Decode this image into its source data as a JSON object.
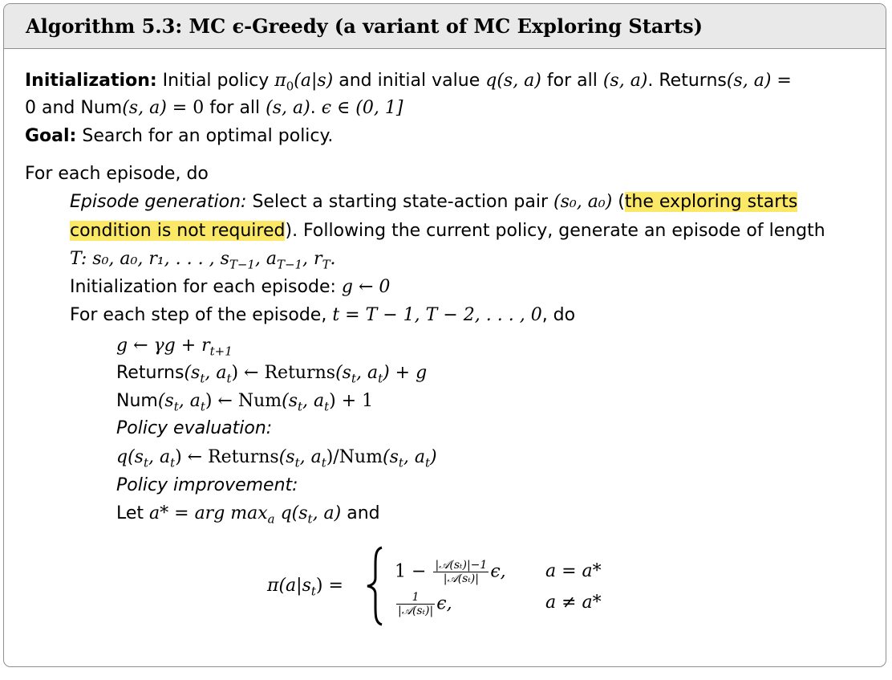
{
  "algorithm": {
    "title": "Algorithm 5.3: MC ϵ-Greedy (a variant of MC Exploring Starts)"
  },
  "init": {
    "label": "Initialization:",
    "text1a": "Initial policy ",
    "pi0": "π",
    "pi0_sub": "0",
    "text1b": "(a|s)",
    "text1c": " and initial value ",
    "q_sa": "q(s, a)",
    "text1d": " for all ",
    "sa1": "(s, a)",
    "text1e": ". Returns",
    "sa2": "(s, a)",
    "eq": " =",
    "text2a": "0 and Num",
    "sa3": "(s, a)",
    "text2b": " = 0",
    "text2c": " for all ",
    "sa4": "(s, a)",
    "text2d": ". ",
    "eps_range": "ϵ ∈ (0, 1]"
  },
  "goal": {
    "label": "Goal:",
    "text": " Search for an optimal policy."
  },
  "loop": {
    "for_each_episode": "For each episode, do",
    "episode_generation_label": "Episode generation:",
    "episode_generation_text1": " Select a starting state-action pair ",
    "s0a0": "(s₀, a₀)",
    "paren_open": " (",
    "highlight1": "the exploring starts",
    "highlight2": "condition is not required",
    "after_highlight": "). Following the current policy, generate an episode of length",
    "T_line": "T:  s₀, a₀, r₁, . . . , s",
    "T_line_sub1": "T−1",
    "T_line_mid": ", a",
    "T_line_sub2": "T−1",
    "T_line_mid2": ", r",
    "T_line_sub3": "T",
    "T_line_end": ".",
    "init_each_episode": "Initialization for each episode:  ",
    "g_init": "g ← 0",
    "for_each_step": "For each step of the episode, ",
    "t_seq": "t = T − 1, T − 2, . . . , 0",
    "do": ", do"
  },
  "inner": {
    "g_update": "g ← γg + r",
    "g_update_sub": "t+1",
    "returns_line_a": "Returns",
    "returns_line_b": "(s",
    "returns_line_c": ", a",
    "returns_line_d": ") ← Returns",
    "returns_line_e": "(s",
    "returns_line_f": ", a",
    "returns_line_g": ") + g",
    "num_line_a": "Num",
    "num_line_b": "(s",
    "num_line_c": ", a",
    "num_line_d": ") ← Num",
    "num_line_e": "(s",
    "num_line_f": ", a",
    "num_line_g": ") + 1",
    "policy_eval_label": "Policy evaluation:",
    "q_line_a": "q(s",
    "q_line_b": ", a",
    "q_line_c": ") ← Returns",
    "q_line_d": "(s",
    "q_line_e": ", a",
    "q_line_f": ")/Num",
    "q_line_g": "(s",
    "q_line_h": ", a",
    "q_line_i": ")",
    "policy_impr_label": "Policy improvement:",
    "let_a": "Let ",
    "a_star": "a* = arg max",
    "a_star_sub": "a",
    "a_star_rest": " q(s",
    "a_star_rest2": ", a)",
    "and": " and"
  },
  "formula": {
    "lhs": "π(a|s",
    "lhs_sub": "t",
    "lhs_end": ") =",
    "case1_prefix": "1 −",
    "case1_num": "|𝒜(sₜ)|−1",
    "case1_den": "|𝒜(sₜ)|",
    "case1_eps": "ϵ,",
    "case1_cond": "a = a*",
    "case2_num": "1",
    "case2_den": "|𝒜(sₜ)|",
    "case2_eps": "ϵ,",
    "case2_cond": "a ≠ a*"
  },
  "colors": {
    "highlight": "#fbe867",
    "header_bg": "#e9e9e9",
    "border": "#8f8f8f"
  }
}
